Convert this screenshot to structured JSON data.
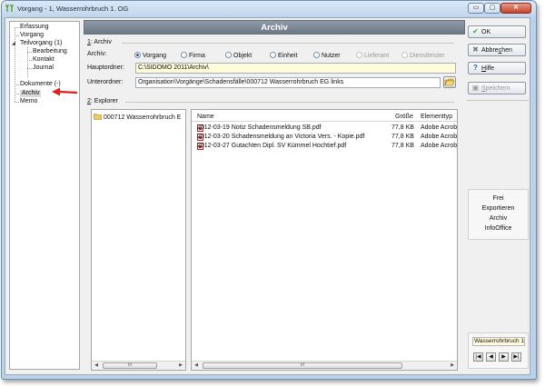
{
  "window": {
    "title": "Vorgang - 1, Wasserrohrbruch 1. OG",
    "controls": {
      "minimize": "▭",
      "maximize": "▢",
      "close": "✕"
    }
  },
  "tree": {
    "items": [
      {
        "label": "Erfassung"
      },
      {
        "label": "Vorgang"
      },
      {
        "label": "Teilvorgang (1)"
      },
      {
        "label": "Bearbeitung"
      },
      {
        "label": "Kontakt"
      },
      {
        "label": "Journal"
      },
      {
        "label": "Dokumente (-)"
      },
      {
        "label": "Archiv"
      },
      {
        "label": "Memo"
      }
    ],
    "selected": "Archiv"
  },
  "header": {
    "title": "Archiv"
  },
  "archiv_section": {
    "number": "1",
    "label": ": Archiv",
    "archiv_label": "Archiv:",
    "radios": [
      {
        "label": "Vorgang",
        "checked": true,
        "disabled": false
      },
      {
        "label": "Firma",
        "checked": false,
        "disabled": false
      },
      {
        "label": "Objekt",
        "checked": false,
        "disabled": false
      },
      {
        "label": "Einheit",
        "checked": false,
        "disabled": false
      },
      {
        "label": "Nutzer",
        "checked": false,
        "disabled": false
      },
      {
        "label": "Lieferant",
        "checked": false,
        "disabled": true
      },
      {
        "label": "Dienstleister",
        "checked": false,
        "disabled": true
      }
    ],
    "hauptordner_label": "Hauptordner:",
    "hauptordner_value": "C:\\SIDOMO 2011\\Archiv\\",
    "unterordner_label": "Unterordner:",
    "unterordner_value": "Organisation\\Vorgänge\\Schadensfälle\\000712 Wasserrohrbruch EG links"
  },
  "explorer_section": {
    "number": "2",
    "label": ": Explorer",
    "folder": "000712 Wasserrohrbruch E",
    "columns": {
      "name": "Name",
      "size": "Größe",
      "type": "Elementtyp"
    },
    "files": [
      {
        "name": "2012-03-19 Notiz Schadensmeldung SB.pdf",
        "size": "77,8 KB",
        "type": "Adobe Acrob"
      },
      {
        "name": "2012-03-20 Schadensmeldung an Victoria Vers. - Kopie.pdf",
        "size": "77,8 KB",
        "type": "Adobe Acrob"
      },
      {
        "name": "2012-03-27 Gutachten Dipl. SV Kümmel Hochtief.pdf",
        "size": "77,8 KB",
        "type": "Adobe Acrob"
      }
    ],
    "scroll_thumb": "III"
  },
  "sidebar": {
    "ok": "OK",
    "cancel": {
      "pre": "Abbre",
      "accel": "c",
      "post": "hen"
    },
    "help": {
      "pre": "",
      "accel": "H",
      "post": "ilfe"
    },
    "save": {
      "pre": "",
      "accel": "S",
      "post": "peichern"
    },
    "menu": [
      "Frei",
      "Exportieren",
      "Archiv",
      "InfoOffice"
    ],
    "nav_label": "Wasserrohrbruch 1",
    "nav_buttons": [
      "|◀",
      "◀",
      "▶",
      "▶|"
    ]
  },
  "colors": {
    "header_bg": "#7a8593",
    "yellow_field": "#fffcdc",
    "accent_arrow": "#e0201b",
    "ok_icon": "#3aa53a",
    "help_icon": "#1f5fbf"
  }
}
